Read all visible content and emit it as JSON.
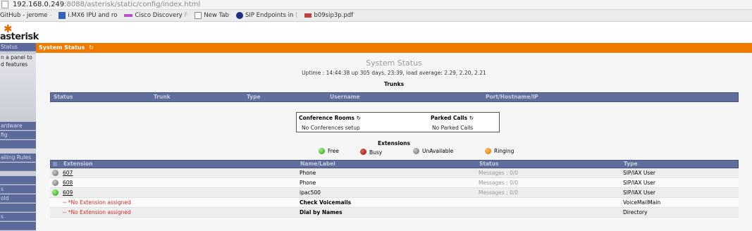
{
  "browser": {
    "url_host": "192.168.0.249",
    "url_rest": ":8088/asterisk/static/config/index.html",
    "bookmarks": [
      {
        "label": "GitHub - jerome",
        "faded": "-"
      },
      {
        "label": "i.MX6 IPU and ro",
        "faded": ""
      },
      {
        "label": "Cisco Discovery",
        "faded": "F"
      },
      {
        "label": "New Tab",
        "faded": ""
      },
      {
        "label": "SIP Endpoints in",
        "faded": "("
      },
      {
        "label": "b09sip3p.pdf",
        "faded": ""
      }
    ]
  },
  "logo": {
    "text": "asterisk"
  },
  "sidebar": {
    "top_item": "Status",
    "info_lines": [
      "n a panel to",
      "d features"
    ],
    "items": [
      "ardware",
      "fig",
      "",
      "ailing Rules",
      "",
      "",
      "s",
      "old",
      "",
      "s",
      ""
    ]
  },
  "titlebar": {
    "label": "System Status",
    "refresh": "↻"
  },
  "main": {
    "title": "System Status",
    "uptime": "Uptime : 14:44:38 up 305 days, 23:39, load average: 2.29, 2.20, 2.21",
    "trunks_title": "Trunks",
    "trunk_columns": [
      "Status",
      "Trunk",
      "Type",
      "Username",
      "Port/Hostname/IP"
    ],
    "conference": {
      "header": "Conference Rooms",
      "icon": "↻",
      "value": "No Conferences setup"
    },
    "parked": {
      "header": "Parked Calls",
      "icon": "↻",
      "value": "No Parked Calls"
    },
    "extensions_title": "Extensions",
    "legend": [
      {
        "label": "Free",
        "color": "green"
      },
      {
        "label": "Busy",
        "color": "red"
      },
      {
        "label": "UnAvailable",
        "color": "gray"
      },
      {
        "label": "Ringing",
        "color": "orange"
      }
    ],
    "ext_columns": [
      "Extension",
      "Name/Label",
      "Status",
      "Type"
    ],
    "ext_rows": [
      {
        "dot": "gray",
        "ext": "607",
        "name": "Phone",
        "status": "Messages : 0/0",
        "type": "SIP/IAX User"
      },
      {
        "dot": "gray",
        "ext": "608",
        "name": "Phone",
        "status": "Messages : 0/0",
        "type": "SIP/IAX User"
      },
      {
        "dot": "green",
        "ext": "609",
        "name": "ipac500",
        "status": "Messages : 0/0",
        "type": "SIP/IAX User"
      },
      {
        "dot": "",
        "ext": "-- *No Extension assigned",
        "name": "Check Voicemails",
        "status": "",
        "type": "VoiceMailMain"
      },
      {
        "dot": "",
        "ext": "-- *No Extension assigned",
        "name": "Dial by Names",
        "status": "",
        "type": "Directory"
      }
    ]
  },
  "colors": {
    "accent": "#f07a00",
    "header_blue": "#5f6e9c",
    "sidebar_blue": "#5b6a9a"
  }
}
